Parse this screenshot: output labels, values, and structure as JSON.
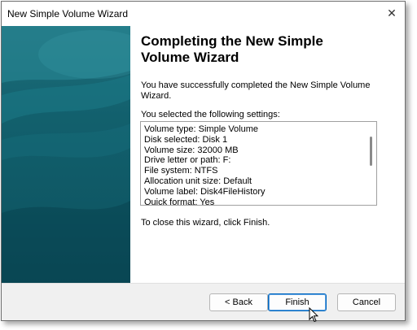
{
  "window": {
    "title": "New Simple Volume Wizard",
    "close_glyph": "✕"
  },
  "content": {
    "heading_line1": "Completing the New Simple",
    "heading_line2": "Volume Wizard",
    "success_line1": "You have successfully completed the New Simple Volume",
    "success_line2": "Wizard.",
    "selected_label": "You selected the following settings:",
    "settings": [
      "Volume type: Simple Volume",
      "Disk selected: Disk 1",
      "Volume size: 32000 MB",
      "Drive letter or path: F:",
      "File system: NTFS",
      "Allocation unit size: Default",
      "Volume label: Disk4FileHistory",
      "Quick format: Yes"
    ],
    "closing_text": "To close this wizard, click Finish."
  },
  "buttons": {
    "back": "< Back",
    "finish": "Finish",
    "cancel": "Cancel"
  },
  "colors": {
    "sidebar": "#12606d",
    "primary_border": "#0067c0"
  }
}
